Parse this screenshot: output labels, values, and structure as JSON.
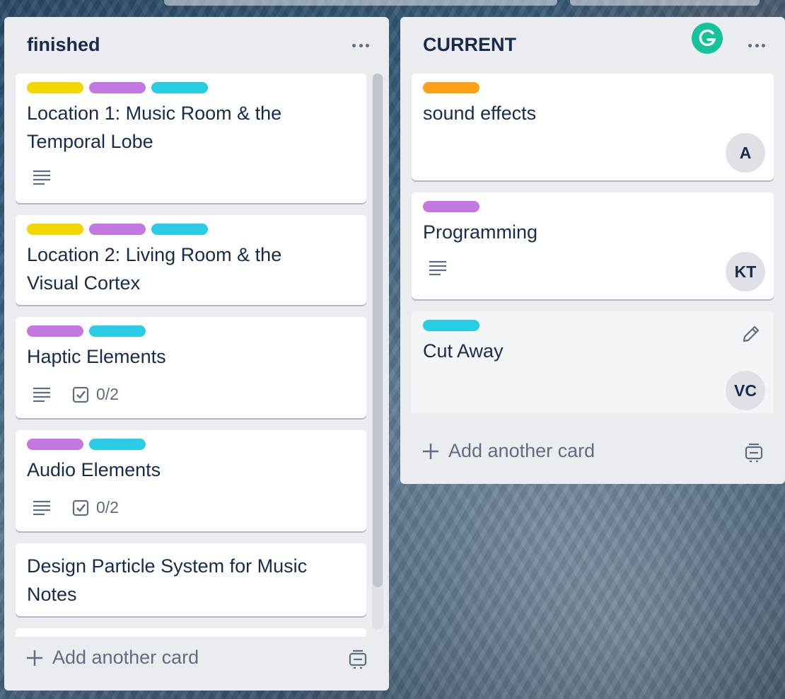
{
  "lists": {
    "finished": {
      "title": "finished",
      "add_card_label": "Add another card",
      "cards": [
        {
          "title": "Location 1: Music Room & the Temporal Lobe",
          "labels": [
            "#f2d600",
            "#c377e0",
            "#29cce5"
          ],
          "badges": {
            "description": true
          }
        },
        {
          "title": "Location 2: Living Room & the Visual Cortex",
          "labels": [
            "#f2d600",
            "#c377e0",
            "#29cce5"
          ],
          "badges": {
            "description": false
          }
        },
        {
          "title": "Haptic Elements",
          "labels": [
            "#c377e0",
            "#29cce5"
          ],
          "badges": {
            "description": true,
            "checklist": "0/2"
          }
        },
        {
          "title": "Audio Elements",
          "labels": [
            "#c377e0",
            "#29cce5"
          ],
          "badges": {
            "description": true,
            "checklist": "0/2"
          }
        },
        {
          "title": "Design Particle System for Music Notes",
          "labels": [],
          "badges": {
            "description": false
          }
        }
      ]
    },
    "current": {
      "title": "CURRENT",
      "add_card_label": "Add another card",
      "cards": [
        {
          "title": "sound effects",
          "labels": [
            "#ff9f1a"
          ],
          "member": "A"
        },
        {
          "title": "Programming",
          "labels": [
            "#c377e0"
          ],
          "member": "KT",
          "badges": {
            "description": true
          }
        },
        {
          "title": "Cut Away",
          "labels": [
            "#29cce5"
          ],
          "member": "VC",
          "hovered": true
        }
      ]
    }
  },
  "colors": {
    "list_bg": "#ebecf0",
    "text": "#172b4d",
    "muted": "#5e6c84",
    "grammarly": "#15c39a"
  }
}
